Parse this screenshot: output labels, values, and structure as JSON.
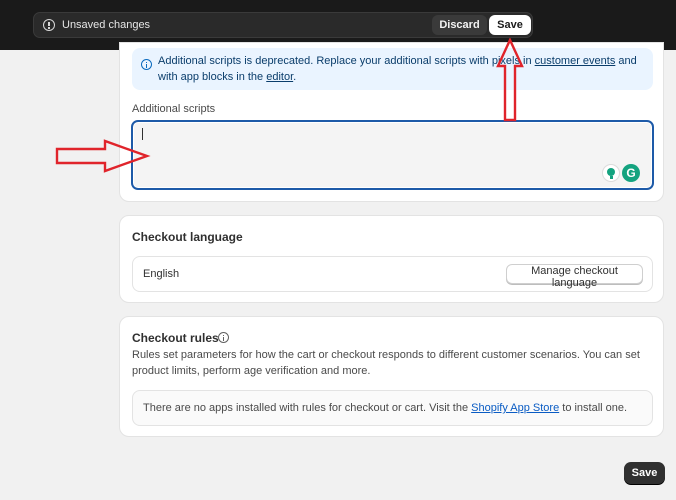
{
  "savebar": {
    "message": "Unsaved changes",
    "discard_label": "Discard",
    "save_label": "Save"
  },
  "scripts_card": {
    "banner_text_before": "Additional scripts is deprecated. Replace your additional scripts with pixels in ",
    "banner_link_1": "customer events",
    "banner_text_middle": " and with app blocks in the ",
    "banner_link_2": "editor",
    "banner_text_after": ".",
    "field_label": "Additional scripts",
    "field_value": ""
  },
  "language_card": {
    "title": "Checkout language",
    "language": "English",
    "manage_label": "Manage checkout language"
  },
  "rules_card": {
    "title": "Checkout rules",
    "description": "Rules set parameters for how the cart or checkout responds to different customer scenarios. You can set product limits, perform age verification and more.",
    "empty_before": "There are no apps installed with rules for checkout or cart. Visit the ",
    "empty_link": "Shopify App Store",
    "empty_after": " to install one."
  },
  "footer": {
    "save_label": "Save"
  },
  "icons": {
    "warning": "alert-circle-icon",
    "info": "info-icon",
    "grammarly_suggest": "lightbulb-icon",
    "grammarly": "grammarly-icon"
  },
  "colors": {
    "savebar_bg": "#1a1a1a",
    "banner_bg": "#eaf4ff",
    "focus_border": "#1d5aa8",
    "primary_button": "#303030",
    "annotation_red": "#e0242b"
  }
}
